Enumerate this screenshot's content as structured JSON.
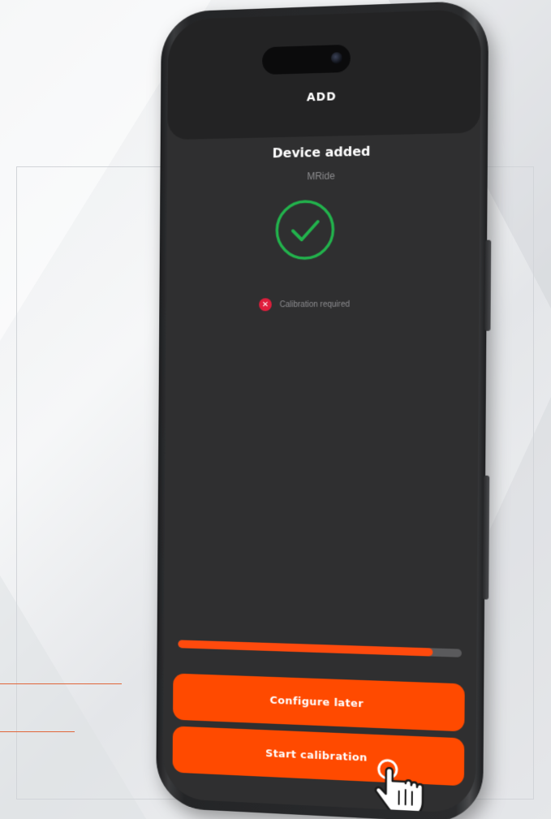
{
  "header": {
    "title": "ADD"
  },
  "device": {
    "status_title": "Device added",
    "name": "MRide"
  },
  "calibration": {
    "status_text": "Calibration required",
    "status_icon": "x-icon"
  },
  "progress": {
    "value_percent": 90
  },
  "actions": {
    "configure_later_label": "Configure later",
    "start_calibration_label": "Start calibration"
  },
  "colors": {
    "accent": "#ff4a00",
    "success": "#22b24c",
    "error": "#e01e3c",
    "screen_bg": "#2f2f30"
  },
  "icons": [
    "camera-icon",
    "checkmark-circle-icon",
    "error-x-icon",
    "tap-hand-icon"
  ]
}
